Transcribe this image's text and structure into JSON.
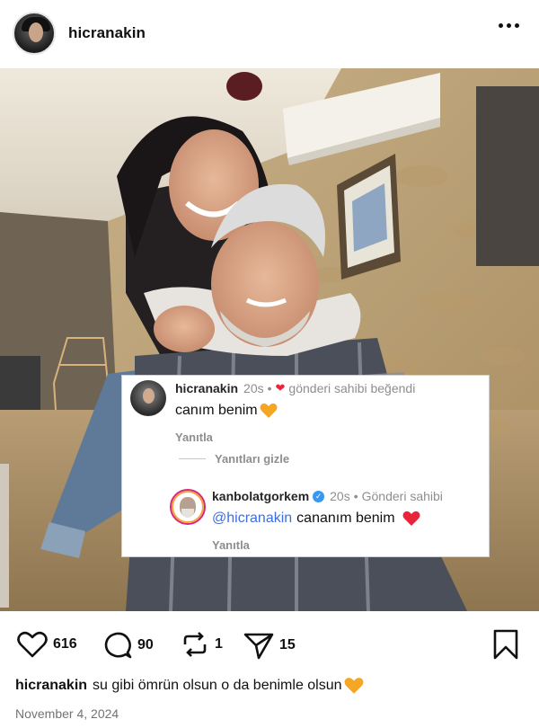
{
  "post": {
    "username": "hicranakin",
    "more_icon": "more-horizontal-icon"
  },
  "comments": {
    "first": {
      "username": "hicranakin",
      "time": "20s",
      "separator": "•",
      "liked_by_author": "gönderi sahibi beğendi",
      "text": "canım benim",
      "reply_label": "Yanıtla"
    },
    "hide_replies": "Yanıtları gizle",
    "reply": {
      "username": "kanbolatgorkem",
      "time": "20s",
      "separator": "•",
      "author_label": "Gönderi sahibi",
      "mention": "@hicranakin",
      "text": "cananım benim",
      "reply_label": "Yanıtla"
    }
  },
  "actions": {
    "likes": "616",
    "comments": "90",
    "reposts": "1",
    "shares": "15"
  },
  "caption": {
    "username": "hicranakin",
    "text": "su gibi ömrün olsun o da benimle olsun"
  },
  "date": "November 4, 2024",
  "colors": {
    "heart_red": "#e8253b",
    "heart_orange": "#f5a623",
    "verified_blue": "#3897f0",
    "mention_blue": "#3d6ee0"
  }
}
